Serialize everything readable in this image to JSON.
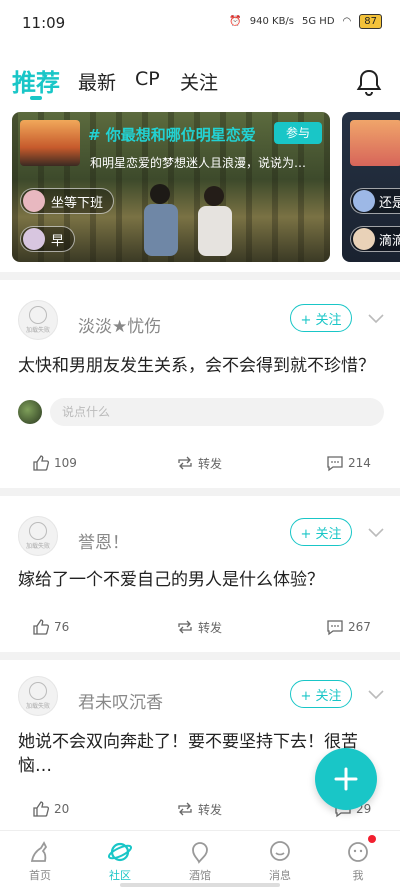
{
  "status_bar": {
    "time": "11:09",
    "net_speed": "940 KB/s",
    "signal": "5G HD",
    "battery": "87"
  },
  "tabs": [
    {
      "label": "推荐",
      "active": true
    },
    {
      "label": "最新",
      "active": false
    },
    {
      "label": "CP",
      "active": false
    },
    {
      "label": "关注",
      "active": false
    }
  ],
  "banner": {
    "title": "# 你最想和哪位明星恋爱",
    "join_label": "参与",
    "description": "和明星恋爱的梦想迷人且浪漫，说说为…",
    "chips": [
      "坐等下班",
      "早"
    ]
  },
  "banner2": {
    "chips": [
      "还是",
      "滴滴"
    ]
  },
  "avatar_placeholder": "加载失败",
  "follow_label": "+ 关注",
  "comment_placeholder": "说点什么",
  "repost_label": "转发",
  "posts": [
    {
      "username": "淡淡★忧伤",
      "title": "太快和男朋友发生关系，会不会得到就不珍惜？",
      "likes": "109",
      "comments": "214"
    },
    {
      "username": "誉恩！",
      "title": "嫁给了一个不爱自己的男人是什么体验？",
      "likes": "76",
      "comments": "267"
    },
    {
      "username": "君未叹沉香",
      "title": "她说不会双向奔赴了！要不要坚持下去！很苦恼…",
      "likes": "20",
      "comments": "29"
    }
  ],
  "bottom_nav": [
    {
      "label": "首页",
      "icon": "home-icon",
      "active": false
    },
    {
      "label": "社区",
      "icon": "planet-icon",
      "active": true
    },
    {
      "label": "酒馆",
      "icon": "tavern-icon",
      "active": false
    },
    {
      "label": "消息",
      "icon": "message-icon",
      "active": false
    },
    {
      "label": "我",
      "icon": "profile-icon",
      "active": false
    }
  ],
  "colors": {
    "accent": "#19c6c7",
    "badge": "#f21f2f"
  }
}
